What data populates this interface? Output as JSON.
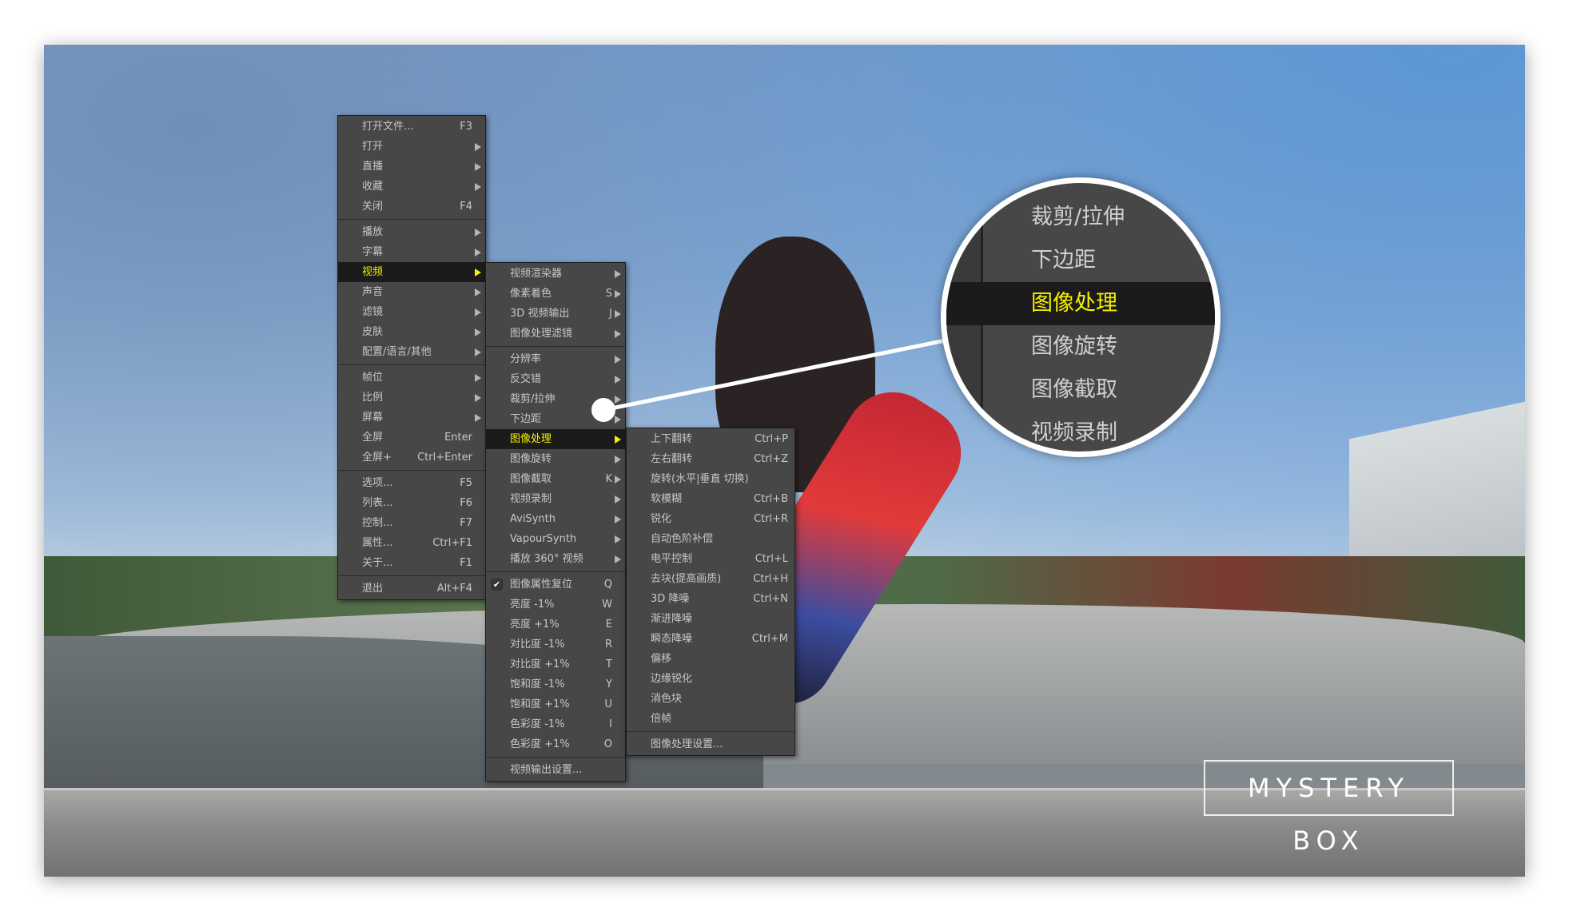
{
  "menus": {
    "main": [
      [
        {
          "label": "打开文件...",
          "shortcut": "F3"
        },
        {
          "label": "打开",
          "submenu": true
        },
        {
          "label": "直播",
          "submenu": true
        },
        {
          "label": "收藏",
          "submenu": true
        },
        {
          "label": "关闭",
          "shortcut": "F4"
        }
      ],
      [
        {
          "label": "播放",
          "submenu": true
        },
        {
          "label": "字幕",
          "submenu": true
        },
        {
          "label": "视频",
          "submenu": true,
          "highlighted": true
        },
        {
          "label": "声音",
          "submenu": true
        },
        {
          "label": "滤镜",
          "submenu": true
        },
        {
          "label": "皮肤",
          "submenu": true
        },
        {
          "label": "配置/语言/其他",
          "submenu": true
        }
      ],
      [
        {
          "label": "帧位",
          "submenu": true
        },
        {
          "label": "比例",
          "submenu": true
        },
        {
          "label": "屏幕",
          "submenu": true
        },
        {
          "label": "全屏",
          "shortcut": "Enter"
        },
        {
          "label": "全屏+",
          "shortcut": "Ctrl+Enter"
        }
      ],
      [
        {
          "label": "选项...",
          "shortcut": "F5"
        },
        {
          "label": "列表...",
          "shortcut": "F6"
        },
        {
          "label": "控制...",
          "shortcut": "F7"
        },
        {
          "label": "属性...",
          "shortcut": "Ctrl+F1"
        },
        {
          "label": "关于...",
          "shortcut": "F1"
        }
      ],
      [
        {
          "label": "退出",
          "shortcut": "Alt+F4"
        }
      ]
    ],
    "video": [
      [
        {
          "label": "视频渲染器",
          "submenu": true
        },
        {
          "label": "像素着色",
          "shortcut": "S",
          "submenu": true
        },
        {
          "label": "3D 视频输出",
          "shortcut": "J",
          "submenu": true
        },
        {
          "label": "图像处理滤镜",
          "submenu": true
        }
      ],
      [
        {
          "label": "分辨率",
          "submenu": true
        },
        {
          "label": "反交错",
          "submenu": true
        },
        {
          "label": "裁剪/拉伸",
          "submenu": true
        },
        {
          "label": "下边距",
          "submenu": true
        },
        {
          "label": "图像处理",
          "submenu": true,
          "highlighted": true
        },
        {
          "label": "图像旋转",
          "submenu": true
        },
        {
          "label": "图像截取",
          "shortcut": "K",
          "submenu": true
        },
        {
          "label": "视频录制",
          "submenu": true
        },
        {
          "label": "AviSynth",
          "submenu": true
        },
        {
          "label": "VapourSynth",
          "submenu": true
        },
        {
          "label": "播放 360° 视频",
          "submenu": true
        }
      ],
      [
        {
          "label": "图像属性复位",
          "shortcut": "Q",
          "checked": true
        },
        {
          "label": "亮度 -1%",
          "shortcut": "W"
        },
        {
          "label": "亮度 +1%",
          "shortcut": "E"
        },
        {
          "label": "对比度 -1%",
          "shortcut": "R"
        },
        {
          "label": "对比度 +1%",
          "shortcut": "T"
        },
        {
          "label": "饱和度 -1%",
          "shortcut": "Y"
        },
        {
          "label": "饱和度 +1%",
          "shortcut": "U"
        },
        {
          "label": "色彩度 -1%",
          "shortcut": "I"
        },
        {
          "label": "色彩度 +1%",
          "shortcut": "O"
        }
      ],
      [
        {
          "label": "视频输出设置..."
        }
      ]
    ],
    "image_processing": [
      [
        {
          "label": "上下翻转",
          "shortcut": "Ctrl+P"
        },
        {
          "label": "左右翻转",
          "shortcut": "Ctrl+Z"
        },
        {
          "label": "旋转(水平|垂直 切换)"
        },
        {
          "label": "软模糊",
          "shortcut": "Ctrl+B"
        },
        {
          "label": "锐化",
          "shortcut": "Ctrl+R"
        },
        {
          "label": "自动色阶补偿"
        },
        {
          "label": "电平控制",
          "shortcut": "Ctrl+L"
        },
        {
          "label": "去块(提高画质)",
          "shortcut": "Ctrl+H"
        },
        {
          "label": "3D 降噪",
          "shortcut": "Ctrl+N"
        },
        {
          "label": "渐进降噪"
        },
        {
          "label": "瞬态降噪",
          "shortcut": "Ctrl+M"
        },
        {
          "label": "偏移"
        },
        {
          "label": "边缘锐化"
        },
        {
          "label": "消色块"
        },
        {
          "label": "倍帧"
        }
      ],
      [
        {
          "label": "图像处理设置..."
        }
      ]
    ]
  },
  "magnifier": {
    "items": [
      {
        "label": "裁剪/拉伸"
      },
      {
        "label": "下边距"
      },
      {
        "label": "图像处理",
        "highlighted": true
      },
      {
        "label": "图像旋转"
      },
      {
        "label": "图像截取"
      },
      {
        "label": "视频录制"
      }
    ]
  },
  "brand": {
    "logo_text": "MYSTERY BOX"
  },
  "colors": {
    "highlight_text": "#f5ef00",
    "menu_bg": "#474747",
    "highlight_bg": "#1b1b1b"
  }
}
